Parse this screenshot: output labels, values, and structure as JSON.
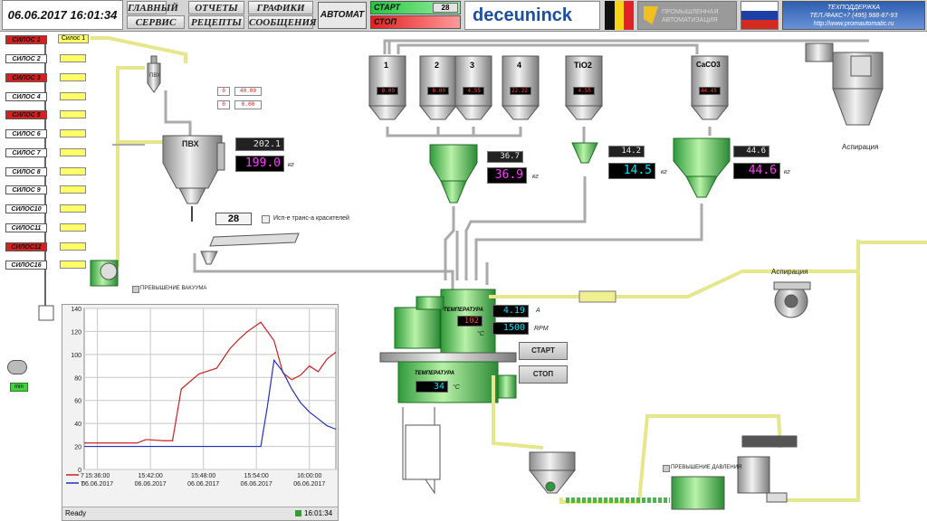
{
  "header": {
    "datetime": "06.06.2017 16:01:34",
    "nav": [
      "ГЛАВНЫЙ",
      "ОТЧЕТЫ",
      "ГРАФИКИ",
      "СЕРВИС",
      "РЕЦЕПТЫ",
      "СООБЩЕНИЯ"
    ],
    "mode": "АВТОМАТ",
    "start_label": "СТАРТ",
    "stop_label": "СТОП",
    "counter": "28",
    "brand": "deceuninck",
    "partner_logo_text": "ПРОМЫШЛЕННАЯ АВТОМАТИЗАЦИЯ",
    "support": {
      "line1": "ТЕХПОДДЕРЖКА",
      "line2": "ТЕЛ./ФАКС+7 (495) 988-87-93",
      "line3": "http://www.promautomatic.ru"
    }
  },
  "silos": [
    {
      "label": "СИЛОС 1",
      "alarm": true
    },
    {
      "label": "СИЛОС 2",
      "alarm": false
    },
    {
      "label": "СИЛОС 3",
      "alarm": true
    },
    {
      "label": "СИЛОС 4",
      "alarm": false
    },
    {
      "label": "СИЛОС 5",
      "alarm": true
    },
    {
      "label": "СИЛОС 6",
      "alarm": false
    },
    {
      "label": "СИЛОС 7",
      "alarm": false
    },
    {
      "label": "СИЛОС 8",
      "alarm": false
    },
    {
      "label": "СИЛОС 9",
      "alarm": false
    },
    {
      "label": "СИЛОС10",
      "alarm": false
    },
    {
      "label": "СИЛОС11",
      "alarm": false
    },
    {
      "label": "СИЛОС12",
      "alarm": true
    },
    {
      "label": "СИЛОС16",
      "alarm": false
    }
  ],
  "silo1_tag": "Силос 1",
  "pvc": {
    "label": "ПВХ",
    "small_label": "ПВХ",
    "setpoint": "202.1",
    "weight": "199.0",
    "unit": "кг",
    "aux1_a": "0",
    "aux1_b": "40.09",
    "aux2_a": "0",
    "aux2_b": "0.00"
  },
  "dye": {
    "count": "28",
    "label": "Исп-е транс-а красителей"
  },
  "vacuum_alarm": "ПРЕВЫШЕНИЕ ВАКУУМА",
  "pressure_alarm": "ПРЕВЫШЕНИЕ ДАВЛЕНИЯ",
  "hoppers": [
    {
      "label": "1",
      "display": "0.00"
    },
    {
      "label": "2",
      "display": "0.00"
    },
    {
      "label": "3",
      "display": "4.55"
    },
    {
      "label": "4",
      "display": "22.22"
    },
    {
      "label": "TiO2",
      "display": "4.55"
    },
    {
      "label": "CaCO3",
      "display": "44.45"
    }
  ],
  "scales": [
    {
      "setpoint": "36.7",
      "weight": "36.9",
      "unit": "кг"
    },
    {
      "setpoint": "14.2",
      "weight": "14.5",
      "unit": "кг"
    },
    {
      "setpoint": "44.6",
      "weight": "44.6",
      "unit": "кг"
    }
  ],
  "aspiration_top": "Аспирация",
  "aspiration_mid": "Аспирация",
  "mixer": {
    "temp_label": "ТЕМПЕРАТУРА",
    "temp_value": "102",
    "temp_unit": "°C",
    "current": "4.19",
    "current_unit": "А",
    "rpm": "1500",
    "rpm_unit": "RPM",
    "start_btn": "СТАРТ",
    "stop_btn": "СТОП",
    "cooler_temp_label": "ТЕМПЕРАТУРА",
    "cooler_temp_value": "34",
    "cooler_temp_unit": "°C"
  },
  "vacuum_pump_status": "min",
  "trend": {
    "status": "Ready",
    "clock": "16:01:34",
    "legend": [
      "7",
      "7"
    ]
  },
  "chart_data": {
    "type": "line",
    "title": "",
    "xlabel": "",
    "ylabel": "",
    "ylim": [
      0,
      140
    ],
    "yticks": [
      0,
      20,
      40,
      60,
      80,
      100,
      120,
      140
    ],
    "xticks": [
      {
        "time": "15:36:00",
        "date": "06.06.2017"
      },
      {
        "time": "15:42:00",
        "date": "06.06.2017"
      },
      {
        "time": "15:48:00",
        "date": "06.06.2017"
      },
      {
        "time": "15:54:00",
        "date": "06.06.2017"
      },
      {
        "time": "16:00:00",
        "date": "06.06.2017"
      }
    ],
    "x_minutes": [
      0,
      12,
      14,
      18,
      20,
      22,
      26,
      30,
      33,
      35,
      37,
      40,
      41.5,
      43,
      45,
      47,
      49,
      51,
      53,
      55,
      57
    ],
    "series": [
      {
        "color": "#d02020",
        "values": [
          23,
          23,
          26,
          25,
          25,
          70,
          83,
          88,
          105,
          113,
          120,
          128,
          120,
          112,
          84,
          78,
          82,
          90,
          85,
          96,
          102
        ]
      },
      {
        "color": "#2030c0",
        "values": [
          20,
          20,
          20,
          20,
          20,
          20,
          20,
          20,
          20,
          20,
          20,
          20,
          55,
          95,
          85,
          70,
          58,
          50,
          44,
          38,
          35
        ]
      }
    ]
  }
}
